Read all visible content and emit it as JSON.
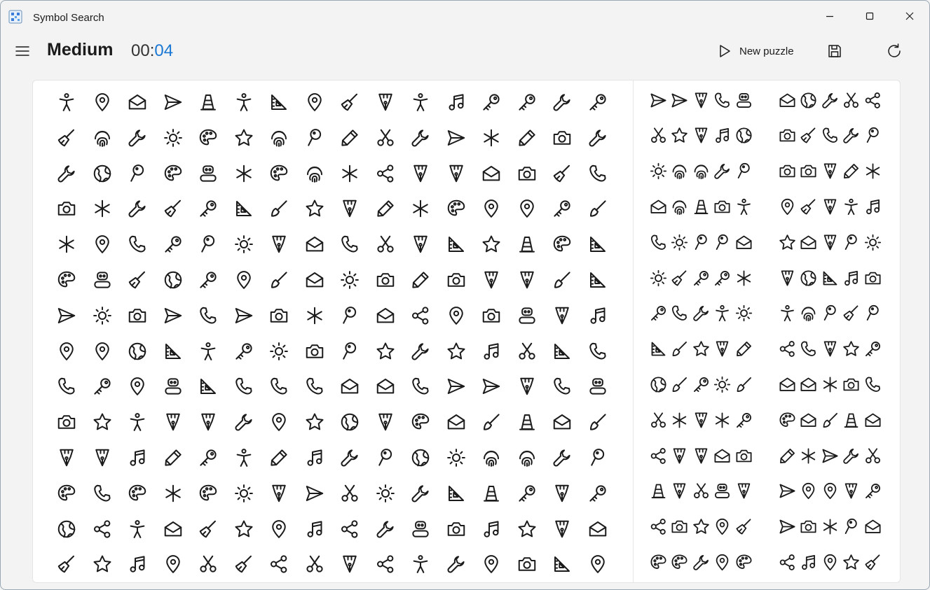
{
  "window": {
    "title": "Symbol Search",
    "minimize_icon": "minimize-icon",
    "maximize_icon": "maximize-icon",
    "close_icon": "close-icon"
  },
  "header": {
    "difficulty": "Medium",
    "timer_prefix": "00:",
    "timer_seconds": "04",
    "timer_accent_color": "#1a78d4",
    "new_puzzle_label": "New puzzle"
  },
  "board": {
    "legend": {
      "A": "accessibility-person",
      "P": "map-pin",
      "E": "envelope-open",
      "S": "send-arrow",
      "C": "traffic-cone",
      "R": "ruler-triangle",
      "B": "broom",
      "F": "fountain-pen",
      "M": "music-note",
      "K": "key",
      "W": "wrench",
      "G": "fingerprint",
      "U": "sun",
      "L": "palette",
      "T": "star",
      "Q": "paper-pin",
      "N": "pencil",
      "X": "scissors",
      "H": "phone",
      "O": "globe",
      "J": "asterisk",
      "Y": "camera",
      "V": "robot",
      "Z": "share-nodes",
      "D": "paintbrush"
    },
    "main_grid": [
      "APESCARPBFAMKKWK",
      "BGWULTGQNXWSJNYW",
      "WOQLVJLGJZFFEYBH",
      "YJWBKRDTFNJLPPKD",
      "JPHKQUFEHXFRTCLR",
      "LVBOKPDEUYNYFFDR",
      "SUYSHSYJQEZPYVFM",
      "PPORAKUYQTWTMXRH",
      "HKPVRHHHEEHSSFHV",
      "YTAFFWPTOFLEDCED",
      "FFMNKANMWQOUGGWQ",
      "LHLJLUFSXUWRCKFK",
      "OZAEBTPMZWVYMTFE",
      "BTMPXBZXFZAWPYRP"
    ],
    "left_puzzles": [
      "SSFHV",
      "XTFMO",
      "UGGWQ",
      "EGCYA",
      "HUQQE",
      "UBKKJ",
      "KHWAU",
      "RDTFN",
      "ODKUD",
      "XJFJK",
      "ZFFEY",
      "CFXVF",
      "ZYTPB",
      "LLWPL"
    ],
    "right_puzzles": [
      "EOWXZ",
      "YBHWQ",
      "YYFNJ",
      "PBFAM",
      "TEFQU",
      "FORMY",
      "AGQBQ",
      "ZHFTK",
      "EEJYH",
      "LEDCE",
      "NJSWX",
      "SPPFK",
      "SYJQE",
      "ZMPTB"
    ]
  }
}
